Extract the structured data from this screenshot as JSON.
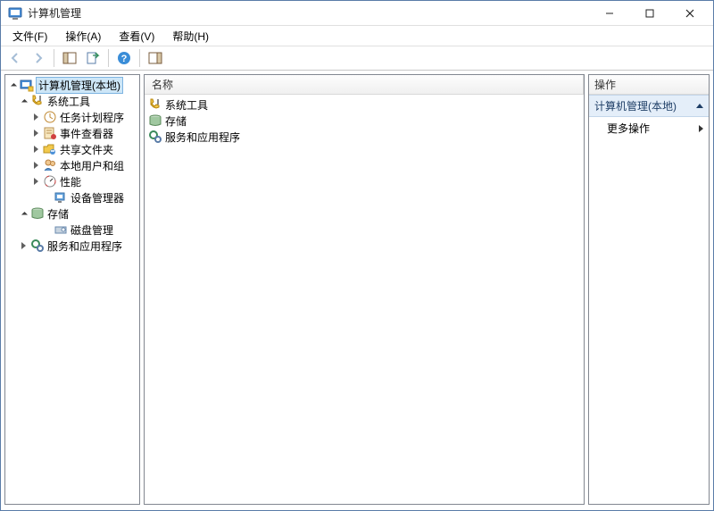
{
  "title": "计算机管理",
  "menus": [
    "文件(F)",
    "操作(A)",
    "查看(V)",
    "帮助(H)"
  ],
  "toolbar": {
    "back": "后退",
    "forward": "前进",
    "show_hide_tree": "显示/隐藏控制台树",
    "export_list": "导出列表",
    "help": "帮助",
    "action_pane": "显示/隐藏操作窗格"
  },
  "tree": {
    "root": "计算机管理(本地)",
    "system_tools": "系统工具",
    "task_scheduler": "任务计划程序",
    "event_viewer": "事件查看器",
    "shared_folders": "共享文件夹",
    "local_users": "本地用户和组",
    "performance": "性能",
    "device_manager": "设备管理器",
    "storage": "存储",
    "disk_mgmt": "磁盘管理",
    "services_apps": "服务和应用程序"
  },
  "list": {
    "column_name": "名称",
    "items": [
      {
        "label": "系统工具"
      },
      {
        "label": "存储"
      },
      {
        "label": "服务和应用程序"
      }
    ]
  },
  "actions": {
    "header": "操作",
    "group": "计算机管理(本地)",
    "more": "更多操作"
  }
}
